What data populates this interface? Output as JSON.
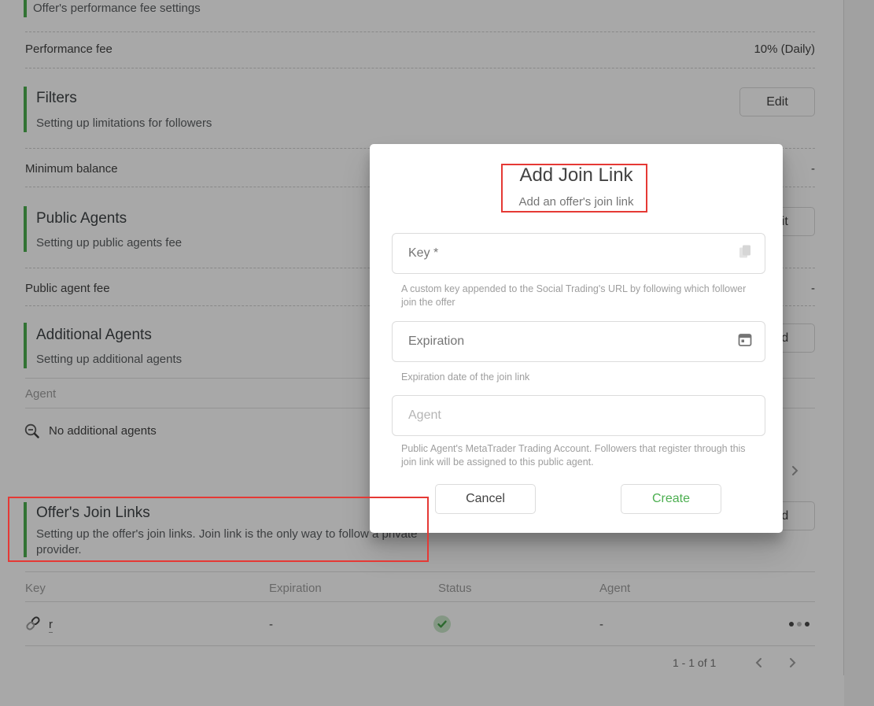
{
  "colors": {
    "accent_green": "#4caf50",
    "annotation_red": "#e53935",
    "create_green": "#4caf50",
    "status_check_bg": "#c8e6c9",
    "status_check": "#43a047"
  },
  "content": {
    "performance_settings_subtitle": "Offer's performance fee settings",
    "performance_fee": {
      "label": "Performance fee",
      "value": "10% (Daily)"
    },
    "filters": {
      "title": "Filters",
      "subtitle": "Setting up limitations for followers",
      "button": "Edit"
    },
    "minimum_balance": {
      "label": "Minimum balance",
      "value": "-"
    },
    "public_agents": {
      "title": "Public Agents",
      "subtitle": "Setting up public agents fee",
      "button": "Edit"
    },
    "public_agent_fee": {
      "label": "Public agent fee",
      "value": "-"
    },
    "additional_agents": {
      "title": "Additional Agents",
      "subtitle": "Setting up additional agents",
      "button": "Add",
      "table": {
        "header": "Agent",
        "empty_text": "No additional agents"
      }
    },
    "join_links": {
      "title": "Offer's Join Links",
      "subtitle": "Setting up the offer's join links. Join link is the only way to follow a private provider.",
      "button": "Add",
      "table": {
        "headers": [
          "Key",
          "Expiration",
          "Status",
          "Agent"
        ],
        "row": {
          "key": "r",
          "expiration": "-",
          "status": "active",
          "agent": "-"
        }
      },
      "pagination": {
        "range": "1 - 1 of 1"
      }
    }
  },
  "modal": {
    "title": "Add Join Link",
    "subtitle": "Add an offer's join link",
    "fields": [
      {
        "placeholder": "Key *",
        "icon": "copy-icon",
        "helper": "A custom key appended to the Social Trading's URL by following which follower join the offer"
      },
      {
        "placeholder": "Expiration",
        "icon": "calendar-icon",
        "helper": "Expiration date of the join link"
      },
      {
        "placeholder": "Agent",
        "icon": "",
        "helper": "Public Agent's MetaTrader Trading Account. Followers that register through this join link will be assigned to this public agent."
      }
    ],
    "cancel_label": "Cancel",
    "create_label": "Create"
  }
}
